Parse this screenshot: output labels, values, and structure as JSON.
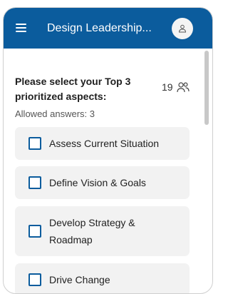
{
  "header": {
    "title": "Design Leadership...",
    "menu_icon": "hamburger-menu-icon",
    "avatar_icon": "user-icon",
    "accent_color": "#0b5c9d"
  },
  "question": {
    "prompt": "Please select your Top 3 prioritized aspects:",
    "response_count": "19",
    "response_icon": "participants-icon",
    "allowed_label": "Allowed answers:",
    "allowed_value": "3"
  },
  "options": [
    {
      "label": "Assess Current Situation",
      "checked": false
    },
    {
      "label": "Define Vision & Goals",
      "checked": false
    },
    {
      "label": "Develop Strategy & Roadmap",
      "checked": false
    },
    {
      "label": "Drive Change",
      "checked": false
    }
  ]
}
